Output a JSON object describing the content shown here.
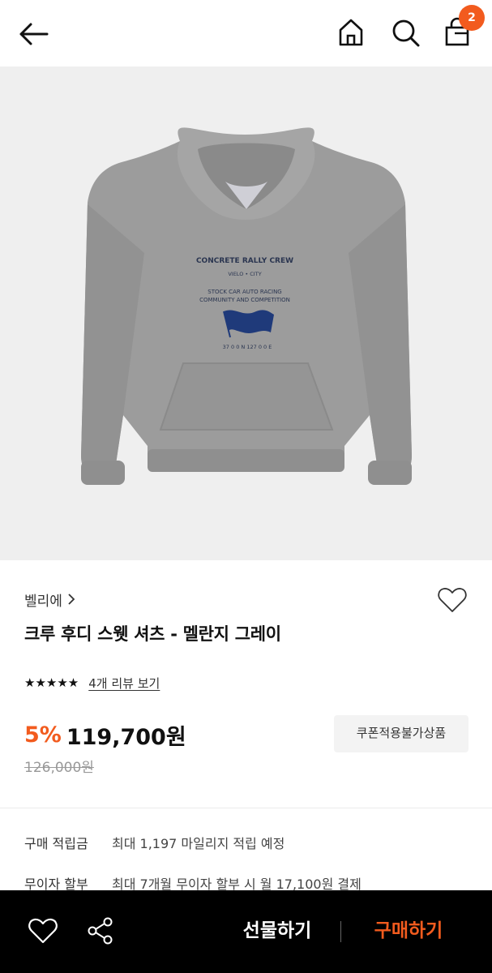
{
  "header": {
    "cart_count": "2",
    "icons": [
      "back-arrow-icon",
      "home-icon",
      "search-icon",
      "shopping-bag-icon"
    ]
  },
  "product": {
    "brand": "벨리에",
    "title": "크루 후디 스웻 셔츠 - 멜란지 그레이",
    "rating": {
      "stars": 5,
      "max": 5
    },
    "review_link": "4개 리뷰 보기",
    "discount": "5%",
    "price": "119,700원",
    "original_price": "126,000원",
    "coupon_button": "쿠폰적용불가상품",
    "image_print": {
      "line1": "CONCRETE RALLY CREW",
      "line2": "VIELO • CITY",
      "line3": "STOCK CAR AUTO RACING",
      "line4": "COMMUNITY AND COMPETITION",
      "line5": "37 0 0 N 127 0 0 E"
    }
  },
  "info": [
    {
      "label": "구매 적립금",
      "value": "최대 1,197 마일리지 적립 예정"
    },
    {
      "label": "무이자 할부",
      "value": "최대 7개월 무이자 할부 시 월 17,100원 결제"
    }
  ],
  "bottom_bar": {
    "gift_label": "선물하기",
    "buy_label": "구매하기"
  },
  "colors": {
    "accent": "#f25b1e",
    "hero_bg": "#efefef",
    "hoodie": "#9c9c9c",
    "bottom_bar": "#000000"
  }
}
